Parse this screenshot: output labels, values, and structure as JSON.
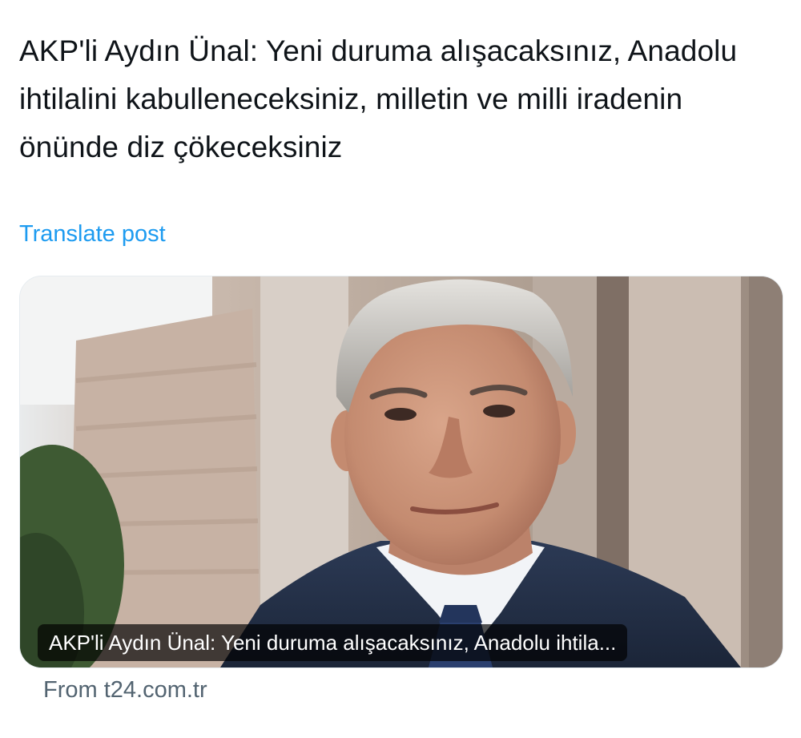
{
  "post": {
    "text": "AKP'li Aydın Ünal: Yeni duruma alışacaksınız, Anadolu ihtilalini kabulleneceksiniz, milletin ve milli iradenin önünde diz çökeceksiniz",
    "translate_label": "Translate post"
  },
  "link_card": {
    "caption": "AKP'li Aydın Ünal: Yeni duruma alışacaksınız, Anadolu ihtila...",
    "source": "From t24.com.tr",
    "image": "portrait photo of a grey-haired man in suit and tie in front of a building"
  },
  "colors": {
    "text": "#0f1419",
    "link": "#1d9bf0",
    "secondary": "#536471"
  }
}
